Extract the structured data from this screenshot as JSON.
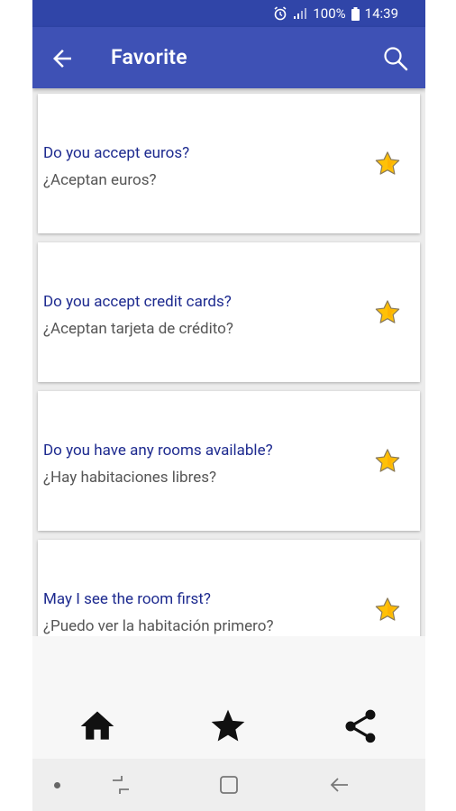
{
  "status_bar": {
    "battery": "100%",
    "time": "14:39"
  },
  "app_bar": {
    "title": "Favorite",
    "back_icon": "arrow-back-icon",
    "search_icon": "search-icon"
  },
  "phrases": [
    {
      "english": "Do you accept euros?",
      "spanish": "¿Aceptan euros?",
      "favorite": true
    },
    {
      "english": "Do you accept credit cards?",
      "spanish": "¿Aceptan tarjeta de crédito?",
      "favorite": true
    },
    {
      "english": "Do you have any rooms available?",
      "spanish": "¿Hay habitaciones libres?",
      "favorite": true
    },
    {
      "english": "May I see the room first?",
      "spanish": "¿Puedo ver la habitación primero?",
      "favorite": true
    }
  ],
  "bottom_nav": {
    "items": [
      "home-icon",
      "star-icon",
      "share-icon"
    ]
  },
  "colors": {
    "app_bar": "#3e51b5",
    "status_bar": "#3045a8",
    "english_text": "#1d2a8f",
    "spanish_text": "#555555",
    "star": "#ffc107"
  }
}
